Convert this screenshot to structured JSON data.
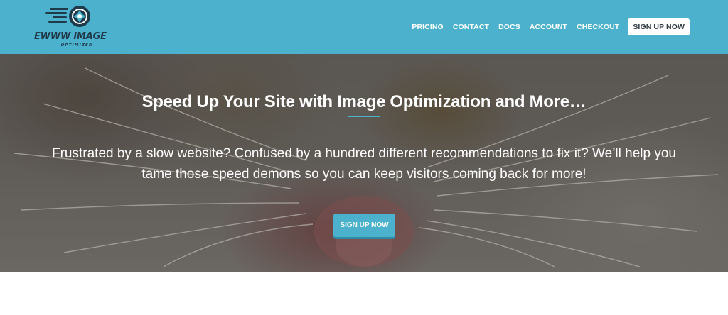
{
  "header": {
    "logo": {
      "wordmark": "EWWW IMAGE",
      "subtext": "OPTIMIZER",
      "icon": "camera-aperture-icon"
    },
    "nav": [
      {
        "label": "PRICING"
      },
      {
        "label": "CONTACT"
      },
      {
        "label": "DOCS"
      },
      {
        "label": "ACCOUNT"
      },
      {
        "label": "CHECKOUT"
      }
    ],
    "cta_label": "SIGN UP NOW"
  },
  "hero": {
    "title": "Speed Up Your Site with Image Optimization and More…",
    "text": "Frustrated by a slow website? Confused by a hundred different recommendations to fix it? We’ll help you tame those speed demons so you can keep visitors coming back for more!",
    "button_label": "SIGN UP NOW",
    "background_image": "yawning-cat-photo"
  },
  "colors": {
    "accent": "#4bb1cc",
    "logo_dark": "#1f3a4a",
    "white": "#ffffff"
  }
}
